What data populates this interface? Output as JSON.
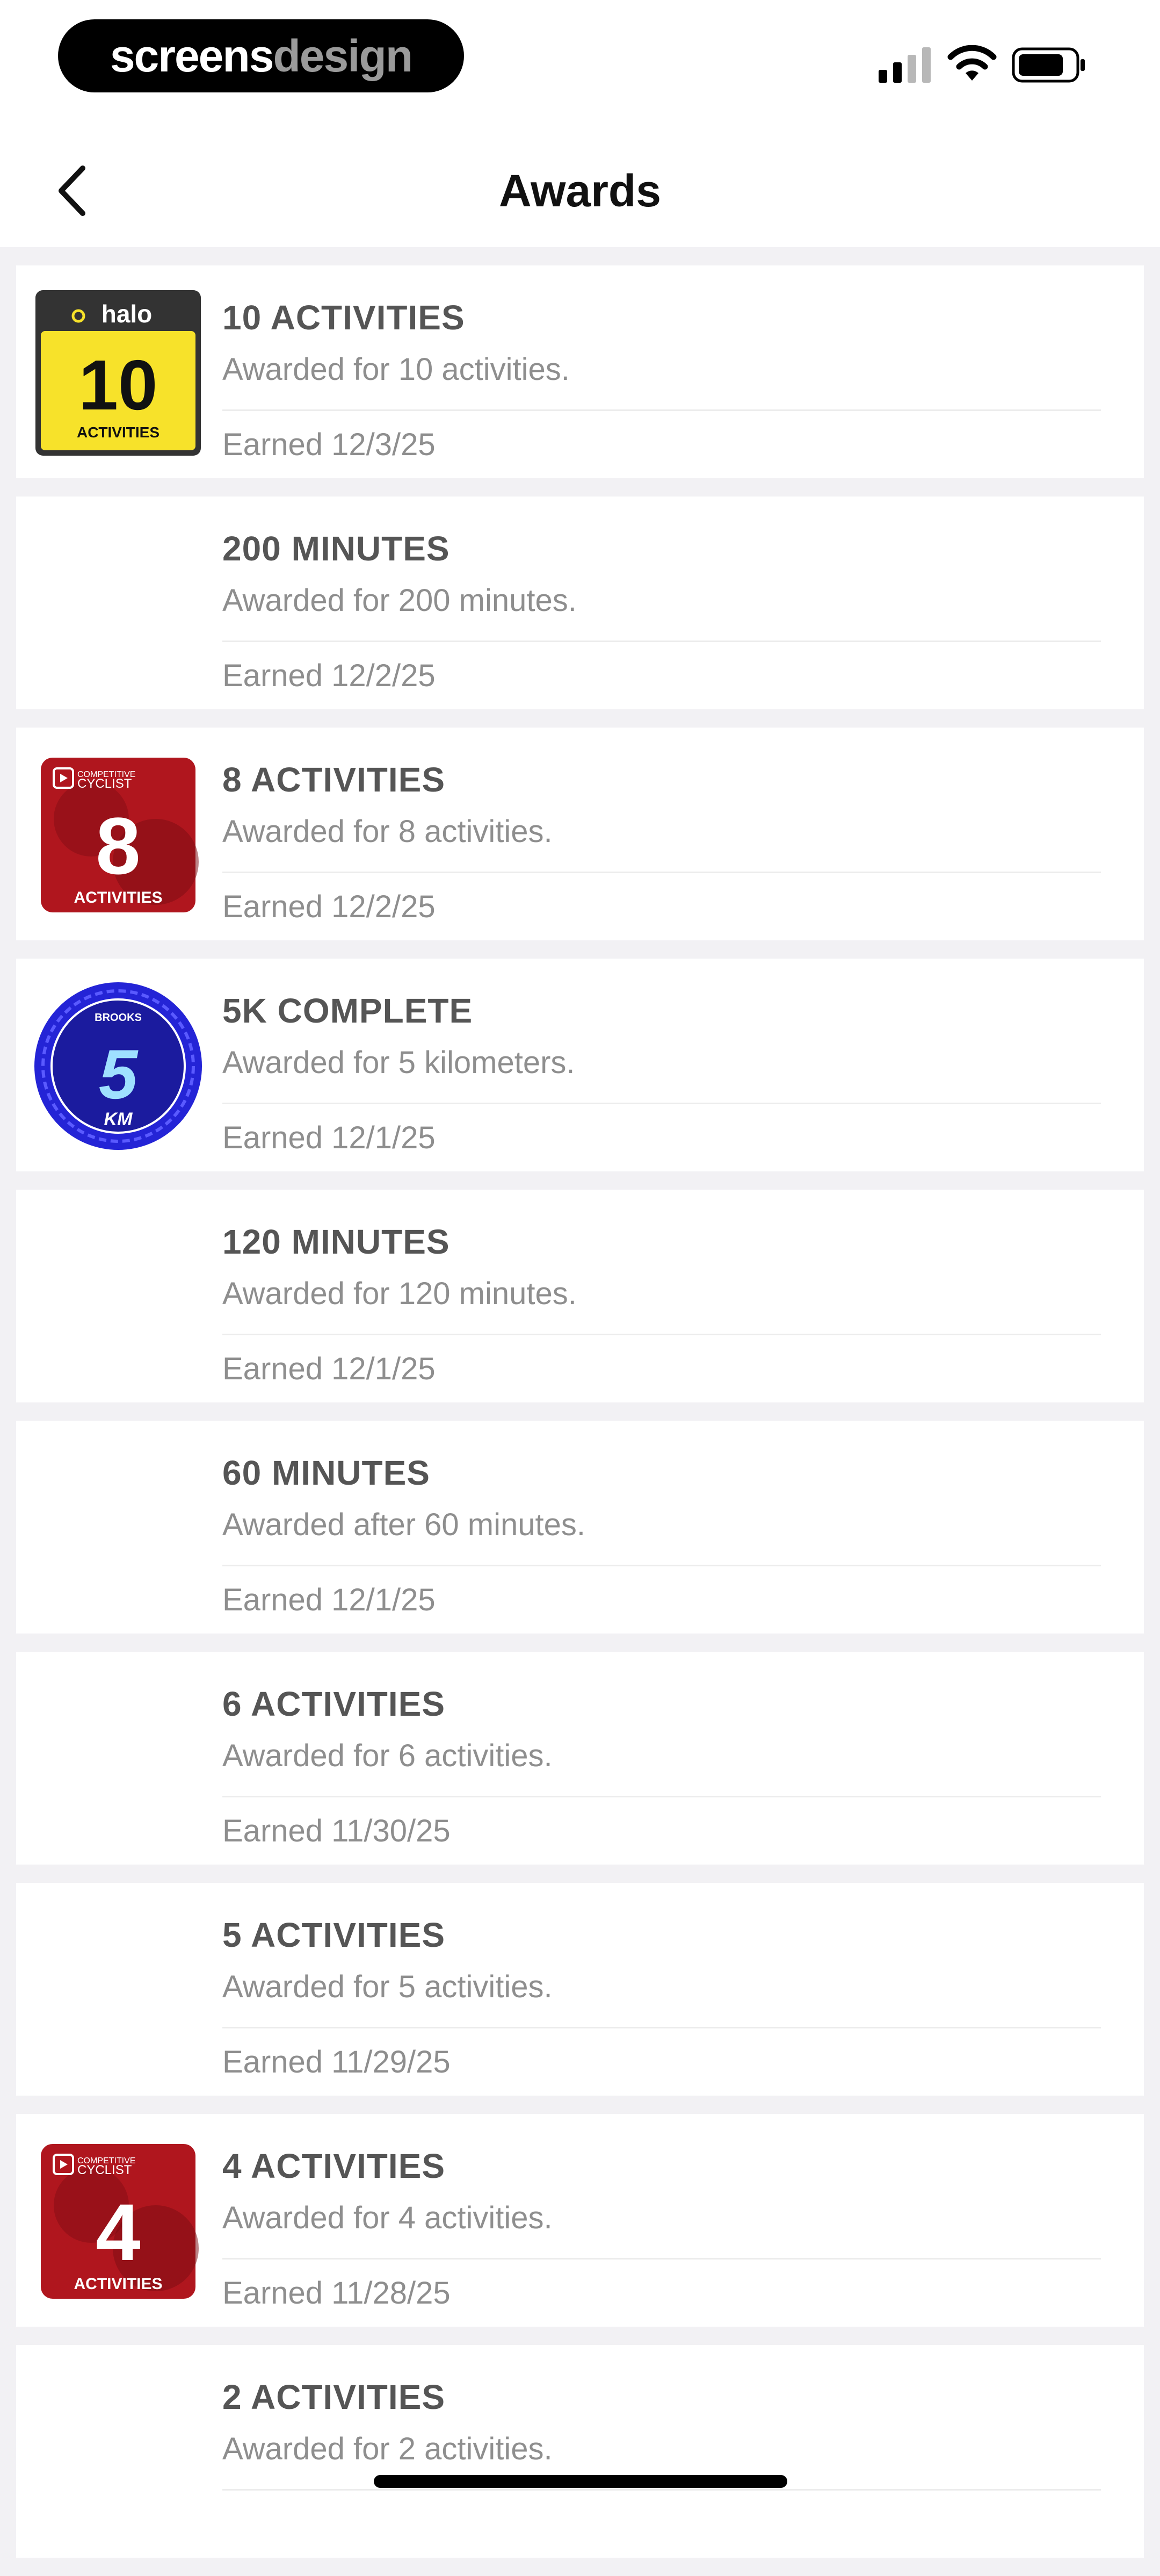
{
  "status_bar": {
    "brand_primary": "screens",
    "brand_secondary": "design",
    "icons": [
      "signal-icon",
      "wifi-icon",
      "battery-icon"
    ]
  },
  "nav": {
    "title": "Awards",
    "back_icon": "chevron-left-icon"
  },
  "awards": [
    {
      "title": "10 ACTIVITIES",
      "desc": "Awarded for 10 activities.",
      "date": "Earned 12/3/25",
      "badge": "halo-10",
      "badge_text": [
        "halo",
        "10",
        "ACTIVITIES"
      ]
    },
    {
      "title": "200 MINUTES",
      "desc": "Awarded for 200 minutes.",
      "date": "Earned 12/2/25",
      "badge": "none"
    },
    {
      "title": "8 ACTIVITIES",
      "desc": "Awarded for 8 activities.",
      "date": "Earned 12/2/25",
      "badge": "cyclist-8",
      "badge_text": [
        "COMPETITIVE",
        "CYCLIST",
        "8",
        "ACTIVITIES"
      ]
    },
    {
      "title": "5K COMPLETE",
      "desc": "Awarded for 5 kilometers.",
      "date": "Earned 12/1/25",
      "badge": "brooks-5k",
      "badge_text": [
        "BROOKS",
        "5",
        "KM"
      ]
    },
    {
      "title": "120 MINUTES",
      "desc": "Awarded for 120 minutes.",
      "date": "Earned 12/1/25",
      "badge": "none"
    },
    {
      "title": "60 MINUTES",
      "desc": "Awarded after 60 minutes.",
      "date": "Earned 12/1/25",
      "badge": "none"
    },
    {
      "title": "6 ACTIVITIES",
      "desc": "Awarded for 6 activities.",
      "date": "Earned 11/30/25",
      "badge": "none"
    },
    {
      "title": "5 ACTIVITIES",
      "desc": "Awarded for 5 activities.",
      "date": "Earned 11/29/25",
      "badge": "none"
    },
    {
      "title": "4 ACTIVITIES",
      "desc": "Awarded for 4 activities.",
      "date": "Earned 11/28/25",
      "badge": "cyclist-4",
      "badge_text": [
        "COMPETITIVE",
        "CYCLIST",
        "4",
        "ACTIVITIES"
      ]
    },
    {
      "title": "2 ACTIVITIES",
      "desc": "Awarded for 2 activities.",
      "date": "",
      "badge": "none"
    }
  ],
  "colors": {
    "background": "#f2f1f4",
    "card": "#ffffff",
    "title": "#555555",
    "secondary": "#8e8e8e",
    "halo_yellow": "#f7e22a",
    "cyclist_red": "#b0161e",
    "brooks_blue": "#1b1bb8"
  }
}
